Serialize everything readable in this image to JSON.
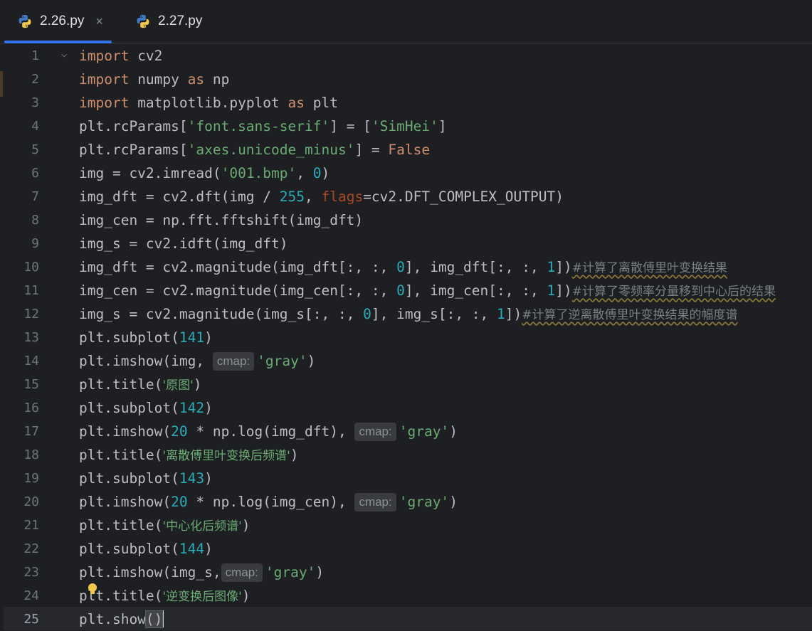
{
  "tabs": [
    {
      "label": "2.26.py",
      "active": true,
      "close": "×"
    },
    {
      "label": "2.27.py",
      "active": false
    }
  ],
  "editor": {
    "current_line": 25,
    "line_numbers": [
      "1",
      "2",
      "3",
      "4",
      "5",
      "6",
      "7",
      "8",
      "9",
      "10",
      "11",
      "12",
      "13",
      "14",
      "15",
      "16",
      "17",
      "18",
      "19",
      "20",
      "21",
      "22",
      "23",
      "24",
      "25"
    ],
    "inlay_hint": "cmap:",
    "lines": [
      [
        [
          "kw",
          "import"
        ],
        [
          "t",
          " cv2"
        ]
      ],
      [
        [
          "kw",
          "import"
        ],
        [
          "t",
          " numpy "
        ],
        [
          "kw",
          "as"
        ],
        [
          "t",
          " np"
        ]
      ],
      [
        [
          "kw",
          "import"
        ],
        [
          "t",
          " matplotlib.pyplot "
        ],
        [
          "kw",
          "as"
        ],
        [
          "t",
          " plt"
        ]
      ],
      [
        [
          "t",
          "plt.rcParams["
        ],
        [
          "str",
          "'font.sans-serif'"
        ],
        [
          "t",
          "] = ["
        ],
        [
          "str",
          "'SimHei'"
        ],
        [
          "t",
          "]"
        ]
      ],
      [
        [
          "t",
          "plt.rcParams["
        ],
        [
          "str",
          "'axes.unicode_minus'"
        ],
        [
          "t",
          "] = "
        ],
        [
          "kw",
          "False"
        ]
      ],
      [
        [
          "t",
          "img = cv2.imread("
        ],
        [
          "str",
          "'001.bmp'"
        ],
        [
          "t",
          ", "
        ],
        [
          "num",
          "0"
        ],
        [
          "t",
          ")"
        ]
      ],
      [
        [
          "t",
          "img_dft = cv2.dft(img / "
        ],
        [
          "num",
          "255"
        ],
        [
          "t",
          ", "
        ],
        [
          "param",
          "flags"
        ],
        [
          "t",
          "=cv2.DFT_COMPLEX_OUTPUT)"
        ]
      ],
      [
        [
          "t",
          "img_cen = np.fft.fftshift(img_dft)"
        ]
      ],
      [
        [
          "t",
          "img_s = cv2.idft(img_dft)"
        ]
      ],
      [
        [
          "t",
          "img_dft = cv2.magnitude(img_dft[:, :, "
        ],
        [
          "num",
          "0"
        ],
        [
          "t",
          "], img_dft[:, :, "
        ],
        [
          "num",
          "1"
        ],
        [
          "t",
          "])"
        ],
        [
          "cmt",
          "#计算了离散傅里叶变换结果"
        ]
      ],
      [
        [
          "t",
          "img_cen = cv2.magnitude(img_cen[:, :, "
        ],
        [
          "num",
          "0"
        ],
        [
          "t",
          "], img_cen[:, :, "
        ],
        [
          "num",
          "1"
        ],
        [
          "t",
          "])"
        ],
        [
          "cmt",
          "#计算了零频率分量移到中心后的结果"
        ]
      ],
      [
        [
          "t",
          "img_s = cv2.magnitude(img_s[:, :, "
        ],
        [
          "num",
          "0"
        ],
        [
          "t",
          "], img_s[:, :, "
        ],
        [
          "num",
          "1"
        ],
        [
          "t",
          "])"
        ],
        [
          "cmt",
          "#计算了逆离散傅里叶变换结果的幅度谱"
        ]
      ],
      [
        [
          "t",
          "plt.subplot("
        ],
        [
          "num",
          "141"
        ],
        [
          "t",
          ")"
        ]
      ],
      [
        [
          "t",
          "plt.imshow(img, "
        ],
        [
          "hint",
          "cmap:"
        ],
        [
          "str",
          "'gray'"
        ],
        [
          "t",
          ")"
        ]
      ],
      [
        [
          "t",
          "plt.title("
        ],
        [
          "str",
          "'原图'"
        ],
        [
          "t",
          ")"
        ]
      ],
      [
        [
          "t",
          "plt.subplot("
        ],
        [
          "num",
          "142"
        ],
        [
          "t",
          ")"
        ]
      ],
      [
        [
          "t",
          "plt.imshow("
        ],
        [
          "num",
          "20"
        ],
        [
          "t",
          " * np.log(img_dft), "
        ],
        [
          "hint",
          "cmap:"
        ],
        [
          "str",
          "'gray'"
        ],
        [
          "t",
          ")"
        ]
      ],
      [
        [
          "t",
          "plt.title("
        ],
        [
          "str",
          "'离散傅里叶变换后频谱'"
        ],
        [
          "t",
          ")"
        ]
      ],
      [
        [
          "t",
          "plt.subplot("
        ],
        [
          "num",
          "143"
        ],
        [
          "t",
          ")"
        ]
      ],
      [
        [
          "t",
          "plt.imshow("
        ],
        [
          "num",
          "20"
        ],
        [
          "t",
          " * np.log(img_cen), "
        ],
        [
          "hint",
          "cmap:"
        ],
        [
          "str",
          "'gray'"
        ],
        [
          "t",
          ")"
        ]
      ],
      [
        [
          "t",
          "plt.title("
        ],
        [
          "str",
          "'中心化后频谱'"
        ],
        [
          "t",
          ")"
        ]
      ],
      [
        [
          "t",
          "plt.subplot("
        ],
        [
          "num",
          "144"
        ],
        [
          "t",
          ")"
        ]
      ],
      [
        [
          "t",
          "plt.imshow(img_s,"
        ],
        [
          "hint",
          "cmap:"
        ],
        [
          "str",
          "'gray'"
        ],
        [
          "t",
          ")"
        ]
      ],
      [
        [
          "t",
          "plt.title("
        ],
        [
          "str",
          "'逆变换后图像'"
        ],
        [
          "t",
          ")"
        ]
      ],
      [
        [
          "t",
          "plt.show"
        ],
        [
          "phl",
          "()"
        ],
        [
          "caret",
          ""
        ]
      ]
    ]
  },
  "colors": {
    "background": "#1e1f22",
    "keyword": "#cf8e6d",
    "string": "#6aab73",
    "number": "#2aacb8",
    "named_param": "#aa4926",
    "comment": "#7a7e85",
    "tab_accent": "#3574f0"
  },
  "icons": {
    "tab_file": "python-icon",
    "gutter_fold": "chevron-down-icon",
    "intention": "lightbulb-icon"
  }
}
